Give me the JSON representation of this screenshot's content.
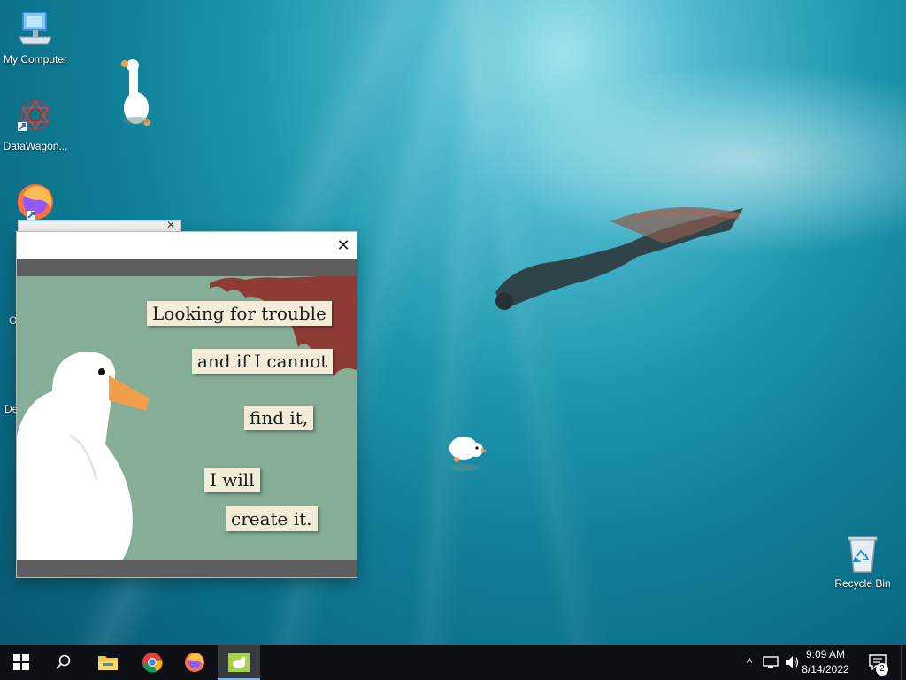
{
  "desktop": {
    "icons": [
      {
        "label": "My Computer"
      },
      {
        "label": "DataWagon..."
      },
      {
        "label": ""
      },
      {
        "label": "Recycle Bin"
      }
    ],
    "partial_labels": [
      "O",
      "De"
    ]
  },
  "goose_window": {
    "lines": [
      "Looking for trouble",
      "and if I cannot",
      "find it,",
      "I will",
      "create it."
    ]
  },
  "taskbar": {
    "time": "9:09 AM",
    "date": "8/14/2022",
    "notification_count": "2",
    "tray_chevron": "^"
  },
  "colors": {
    "taskbar": "#0c0f14",
    "poster_green": "#86ad96",
    "clipping_paper": "#f3ecd8",
    "stain_red": "#8e3b36",
    "goose_beak": "#f0a04a"
  },
  "icons": [
    "windows-logo-icon",
    "search-icon",
    "file-explorer-icon",
    "chrome-icon",
    "firefox-icon",
    "goose-app-icon",
    "network-icon",
    "volume-icon",
    "notification-icon",
    "computer-icon",
    "datawagon-icon",
    "recycle-bin-icon"
  ]
}
